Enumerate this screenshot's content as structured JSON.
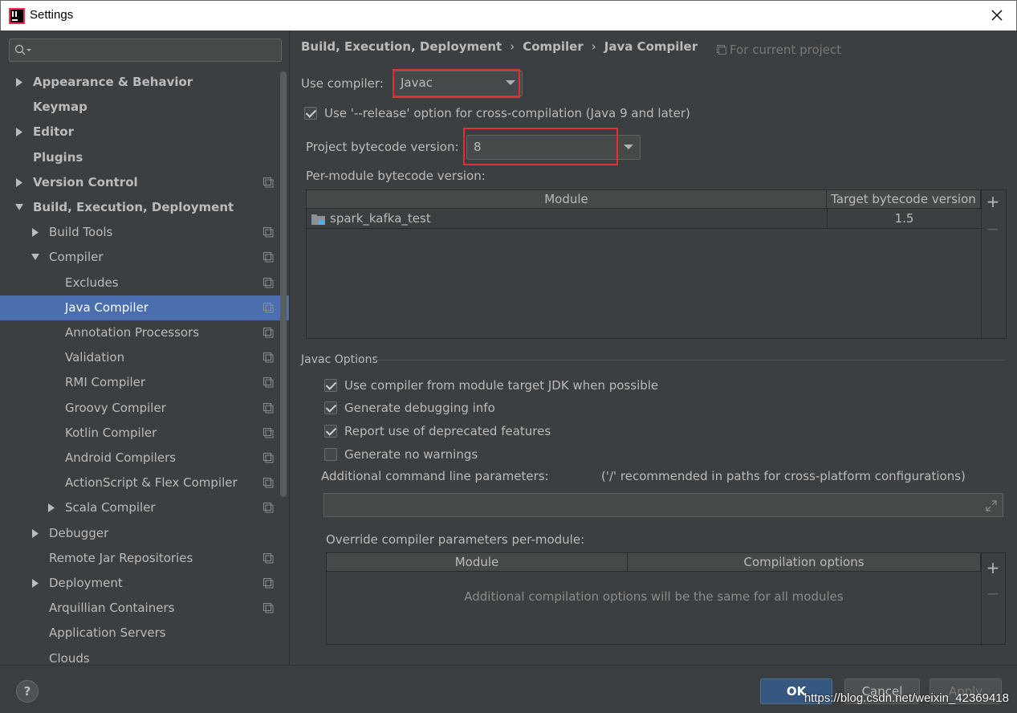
{
  "window": {
    "title": "Settings"
  },
  "sidebar": {
    "search_placeholder": "",
    "items": [
      {
        "label": "Appearance & Behavior",
        "level": 0,
        "bold": true,
        "arrow": "right",
        "project": false
      },
      {
        "label": "Keymap",
        "level": 0,
        "bold": true,
        "arrow": "",
        "project": false
      },
      {
        "label": "Editor",
        "level": 0,
        "bold": true,
        "arrow": "right",
        "project": false
      },
      {
        "label": "Plugins",
        "level": 0,
        "bold": true,
        "arrow": "",
        "project": false
      },
      {
        "label": "Version Control",
        "level": 0,
        "bold": true,
        "arrow": "right",
        "project": true
      },
      {
        "label": "Build, Execution, Deployment",
        "level": 0,
        "bold": true,
        "arrow": "down",
        "project": false
      },
      {
        "label": "Build Tools",
        "level": 1,
        "bold": false,
        "arrow": "right",
        "project": true
      },
      {
        "label": "Compiler",
        "level": 1,
        "bold": false,
        "arrow": "down",
        "project": true
      },
      {
        "label": "Excludes",
        "level": 2,
        "bold": false,
        "arrow": "",
        "project": true
      },
      {
        "label": "Java Compiler",
        "level": 2,
        "bold": false,
        "arrow": "",
        "project": true,
        "selected": true
      },
      {
        "label": "Annotation Processors",
        "level": 2,
        "bold": false,
        "arrow": "",
        "project": true
      },
      {
        "label": "Validation",
        "level": 2,
        "bold": false,
        "arrow": "",
        "project": true
      },
      {
        "label": "RMI Compiler",
        "level": 2,
        "bold": false,
        "arrow": "",
        "project": true
      },
      {
        "label": "Groovy Compiler",
        "level": 2,
        "bold": false,
        "arrow": "",
        "project": true
      },
      {
        "label": "Kotlin Compiler",
        "level": 2,
        "bold": false,
        "arrow": "",
        "project": true
      },
      {
        "label": "Android Compilers",
        "level": 2,
        "bold": false,
        "arrow": "",
        "project": true
      },
      {
        "label": "ActionScript & Flex Compiler",
        "level": 2,
        "bold": false,
        "arrow": "",
        "project": true
      },
      {
        "label": "Scala Compiler",
        "level": 2,
        "bold": false,
        "arrow": "right",
        "project": true
      },
      {
        "label": "Debugger",
        "level": 1,
        "bold": false,
        "arrow": "right",
        "project": false
      },
      {
        "label": "Remote Jar Repositories",
        "level": 1,
        "bold": false,
        "arrow": "",
        "project": true
      },
      {
        "label": "Deployment",
        "level": 1,
        "bold": false,
        "arrow": "right",
        "project": true
      },
      {
        "label": "Arquillian Containers",
        "level": 1,
        "bold": false,
        "arrow": "",
        "project": true
      },
      {
        "label": "Application Servers",
        "level": 1,
        "bold": false,
        "arrow": "",
        "project": false
      },
      {
        "label": "Clouds",
        "level": 1,
        "bold": false,
        "arrow": "",
        "project": false
      }
    ]
  },
  "breadcrumb": {
    "part1": "Build, Execution, Deployment",
    "part2": "Compiler",
    "part3": "Java Compiler",
    "sep": "›"
  },
  "for_project": "For current project",
  "use_compiler": {
    "label": "Use compiler:",
    "value": "Javac"
  },
  "release_option": {
    "label": "Use '--release' option for cross-compilation (Java 9 and later)",
    "checked": true
  },
  "bytecode": {
    "label": "Project bytecode version:",
    "value": "8"
  },
  "per_module": {
    "label": "Per-module bytecode version:",
    "columns": [
      "Module",
      "Target bytecode version"
    ],
    "rows": [
      {
        "module": "spark_kafka_test",
        "version": "1.5"
      }
    ]
  },
  "javac_options": {
    "title": "Javac Options",
    "checkboxes": [
      {
        "label": "Use compiler from module target JDK when possible",
        "checked": true
      },
      {
        "label": "Generate debugging info",
        "checked": true
      },
      {
        "label": "Report use of deprecated features",
        "checked": true
      },
      {
        "label": "Generate no warnings",
        "checked": false
      }
    ],
    "additional_label": "Additional command line parameters:",
    "additional_hint": "('/' recommended in paths for cross-platform configurations)",
    "additional_value": ""
  },
  "override": {
    "label": "Override compiler parameters per-module:",
    "columns": [
      "Module",
      "Compilation options"
    ],
    "empty_text": "Additional compilation options will be the same for all modules"
  },
  "buttons": {
    "ok": "OK",
    "cancel": "Cancel",
    "apply": "Apply",
    "help": "?",
    "plus": "+",
    "minus": "−"
  },
  "watermark": "https://blog.csdn.net/weixin_42369418",
  "colors": {
    "selection": "#4b6eaf",
    "highlight_box": "#e0312f",
    "background": "#3c3f41"
  }
}
